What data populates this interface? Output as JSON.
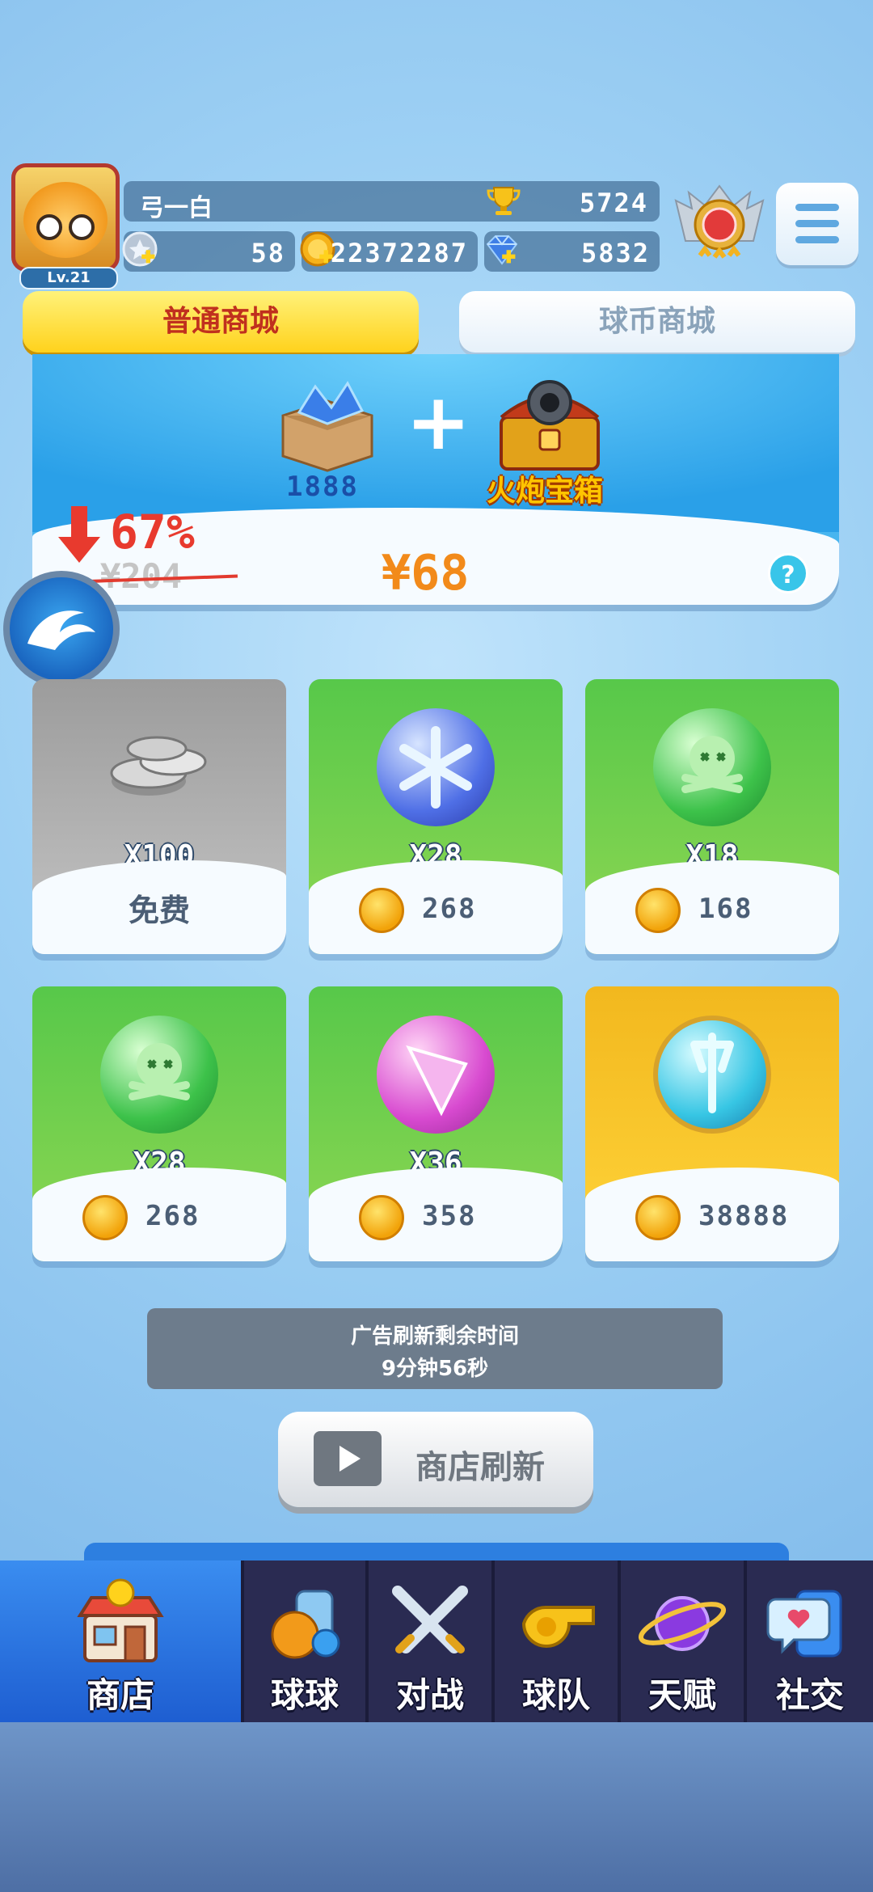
{
  "player": {
    "level": "Lv.21",
    "name": "弓一白",
    "trophies": "5724",
    "tickets": "58",
    "coins": "22372287",
    "gems": "5832"
  },
  "tabs": [
    {
      "label": "普通商城",
      "active": true
    },
    {
      "label": "球币商城",
      "active": false
    }
  ],
  "banner": {
    "item1_label": "1888",
    "item2_label": "火炮宝箱",
    "discount": "67%",
    "old_price": "¥204",
    "new_price": "¥68",
    "help": "?"
  },
  "shop_items": [
    {
      "qty": "X100",
      "price": "",
      "free_label": "免费",
      "theme": "gray",
      "icon": "silver-coins-icon"
    },
    {
      "qty": "X28",
      "price": "268",
      "theme": "green",
      "icon": "ice-ball-icon"
    },
    {
      "qty": "X18",
      "price": "168",
      "theme": "green",
      "icon": "poison-skull-ball-icon"
    },
    {
      "qty": "X28",
      "price": "268",
      "theme": "green",
      "icon": "poison-skull-ball-icon"
    },
    {
      "qty": "X36",
      "price": "358",
      "theme": "green",
      "icon": "pink-crystal-ball-icon"
    },
    {
      "qty": "",
      "price": "38888",
      "theme": "yellow",
      "icon": "cyan-trident-ball-icon"
    }
  ],
  "ad_refresh": {
    "line1": "广告刷新剩余时间",
    "line2": "9分钟56秒"
  },
  "refresh_button": "商店刷新",
  "nav": [
    {
      "label": "商店",
      "icon": "shop-icon",
      "active": true
    },
    {
      "label": "球球",
      "icon": "balls-icon",
      "active": false
    },
    {
      "label": "对战",
      "icon": "crossed-swords-icon",
      "active": false
    },
    {
      "label": "球队",
      "icon": "whistle-icon",
      "active": false
    },
    {
      "label": "天赋",
      "icon": "planet-orb-icon",
      "active": false
    },
    {
      "label": "社交",
      "icon": "chat-bubble-icon",
      "active": false
    }
  ],
  "colors": {
    "tab_active": "#ffd21c",
    "tab_active_text": "#c0301e",
    "price_orange": "#f28a1a",
    "discount_red": "#e83a2e",
    "nav_bg": "#2a2b52",
    "nav_active": "#1e5ed1"
  }
}
